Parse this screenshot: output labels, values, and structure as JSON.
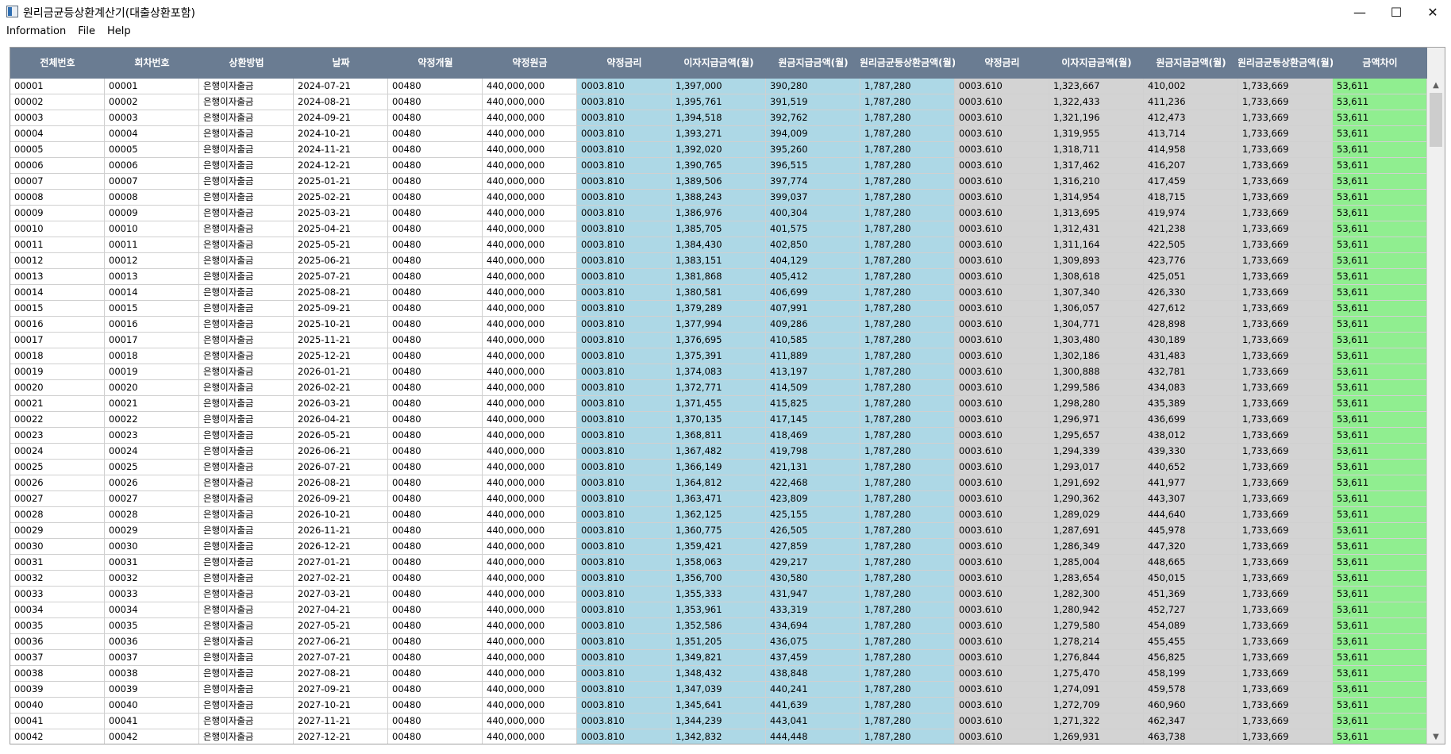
{
  "window": {
    "title": "원리금균등상환계산기(대출상환포함)",
    "controls": {
      "minimize": "—",
      "maximize": "☐",
      "close": "✕"
    }
  },
  "menu": [
    "Information",
    "File",
    "Help"
  ],
  "columns": [
    "전체번호",
    "회차번호",
    "상환방법",
    "날짜",
    "약정개월",
    "약정원금",
    "약정금리",
    "이자지급금액(월)",
    "원금지급금액(월)",
    "원리금균등상환금액(월)",
    "약정금리",
    "이자지급금액(월)",
    "원금지급금액(월)",
    "원리금균등상환금액(월)",
    "금액차이"
  ],
  "column_colors": {
    "blue": "#add8e6",
    "gray": "#d3d3d3",
    "green": "#90ee90",
    "header": "#6a7c92"
  },
  "constants": {
    "method": "은행이자출금",
    "months": "00480",
    "principal": "440,000,000",
    "rate1": "0003.810",
    "total1": "1,787,280",
    "rate2": "0003.610",
    "total2": "1,733,669",
    "diff": "53,611"
  },
  "rows": [
    {
      "no": "00001",
      "round": "00001",
      "date": "2024-07-21",
      "int1": "1,397,000",
      "prin1": "390,280",
      "int2": "1,323,667",
      "prin2": "410,002"
    },
    {
      "no": "00002",
      "round": "00002",
      "date": "2024-08-21",
      "int1": "1,395,761",
      "prin1": "391,519",
      "int2": "1,322,433",
      "prin2": "411,236"
    },
    {
      "no": "00003",
      "round": "00003",
      "date": "2024-09-21",
      "int1": "1,394,518",
      "prin1": "392,762",
      "int2": "1,321,196",
      "prin2": "412,473"
    },
    {
      "no": "00004",
      "round": "00004",
      "date": "2024-10-21",
      "int1": "1,393,271",
      "prin1": "394,009",
      "int2": "1,319,955",
      "prin2": "413,714"
    },
    {
      "no": "00005",
      "round": "00005",
      "date": "2024-11-21",
      "int1": "1,392,020",
      "prin1": "395,260",
      "int2": "1,318,711",
      "prin2": "414,958"
    },
    {
      "no": "00006",
      "round": "00006",
      "date": "2024-12-21",
      "int1": "1,390,765",
      "prin1": "396,515",
      "int2": "1,317,462",
      "prin2": "416,207"
    },
    {
      "no": "00007",
      "round": "00007",
      "date": "2025-01-21",
      "int1": "1,389,506",
      "prin1": "397,774",
      "int2": "1,316,210",
      "prin2": "417,459"
    },
    {
      "no": "00008",
      "round": "00008",
      "date": "2025-02-21",
      "int1": "1,388,243",
      "prin1": "399,037",
      "int2": "1,314,954",
      "prin2": "418,715"
    },
    {
      "no": "00009",
      "round": "00009",
      "date": "2025-03-21",
      "int1": "1,386,976",
      "prin1": "400,304",
      "int2": "1,313,695",
      "prin2": "419,974"
    },
    {
      "no": "00010",
      "round": "00010",
      "date": "2025-04-21",
      "int1": "1,385,705",
      "prin1": "401,575",
      "int2": "1,312,431",
      "prin2": "421,238"
    },
    {
      "no": "00011",
      "round": "00011",
      "date": "2025-05-21",
      "int1": "1,384,430",
      "prin1": "402,850",
      "int2": "1,311,164",
      "prin2": "422,505"
    },
    {
      "no": "00012",
      "round": "00012",
      "date": "2025-06-21",
      "int1": "1,383,151",
      "prin1": "404,129",
      "int2": "1,309,893",
      "prin2": "423,776"
    },
    {
      "no": "00013",
      "round": "00013",
      "date": "2025-07-21",
      "int1": "1,381,868",
      "prin1": "405,412",
      "int2": "1,308,618",
      "prin2": "425,051"
    },
    {
      "no": "00014",
      "round": "00014",
      "date": "2025-08-21",
      "int1": "1,380,581",
      "prin1": "406,699",
      "int2": "1,307,340",
      "prin2": "426,330"
    },
    {
      "no": "00015",
      "round": "00015",
      "date": "2025-09-21",
      "int1": "1,379,289",
      "prin1": "407,991",
      "int2": "1,306,057",
      "prin2": "427,612"
    },
    {
      "no": "00016",
      "round": "00016",
      "date": "2025-10-21",
      "int1": "1,377,994",
      "prin1": "409,286",
      "int2": "1,304,771",
      "prin2": "428,898"
    },
    {
      "no": "00017",
      "round": "00017",
      "date": "2025-11-21",
      "int1": "1,376,695",
      "prin1": "410,585",
      "int2": "1,303,480",
      "prin2": "430,189"
    },
    {
      "no": "00018",
      "round": "00018",
      "date": "2025-12-21",
      "int1": "1,375,391",
      "prin1": "411,889",
      "int2": "1,302,186",
      "prin2": "431,483"
    },
    {
      "no": "00019",
      "round": "00019",
      "date": "2026-01-21",
      "int1": "1,374,083",
      "prin1": "413,197",
      "int2": "1,300,888",
      "prin2": "432,781"
    },
    {
      "no": "00020",
      "round": "00020",
      "date": "2026-02-21",
      "int1": "1,372,771",
      "prin1": "414,509",
      "int2": "1,299,586",
      "prin2": "434,083"
    },
    {
      "no": "00021",
      "round": "00021",
      "date": "2026-03-21",
      "int1": "1,371,455",
      "prin1": "415,825",
      "int2": "1,298,280",
      "prin2": "435,389"
    },
    {
      "no": "00022",
      "round": "00022",
      "date": "2026-04-21",
      "int1": "1,370,135",
      "prin1": "417,145",
      "int2": "1,296,971",
      "prin2": "436,699"
    },
    {
      "no": "00023",
      "round": "00023",
      "date": "2026-05-21",
      "int1": "1,368,811",
      "prin1": "418,469",
      "int2": "1,295,657",
      "prin2": "438,012"
    },
    {
      "no": "00024",
      "round": "00024",
      "date": "2026-06-21",
      "int1": "1,367,482",
      "prin1": "419,798",
      "int2": "1,294,339",
      "prin2": "439,330"
    },
    {
      "no": "00025",
      "round": "00025",
      "date": "2026-07-21",
      "int1": "1,366,149",
      "prin1": "421,131",
      "int2": "1,293,017",
      "prin2": "440,652"
    },
    {
      "no": "00026",
      "round": "00026",
      "date": "2026-08-21",
      "int1": "1,364,812",
      "prin1": "422,468",
      "int2": "1,291,692",
      "prin2": "441,977"
    },
    {
      "no": "00027",
      "round": "00027",
      "date": "2026-09-21",
      "int1": "1,363,471",
      "prin1": "423,809",
      "int2": "1,290,362",
      "prin2": "443,307"
    },
    {
      "no": "00028",
      "round": "00028",
      "date": "2026-10-21",
      "int1": "1,362,125",
      "prin1": "425,155",
      "int2": "1,289,029",
      "prin2": "444,640"
    },
    {
      "no": "00029",
      "round": "00029",
      "date": "2026-11-21",
      "int1": "1,360,775",
      "prin1": "426,505",
      "int2": "1,287,691",
      "prin2": "445,978"
    },
    {
      "no": "00030",
      "round": "00030",
      "date": "2026-12-21",
      "int1": "1,359,421",
      "prin1": "427,859",
      "int2": "1,286,349",
      "prin2": "447,320"
    },
    {
      "no": "00031",
      "round": "00031",
      "date": "2027-01-21",
      "int1": "1,358,063",
      "prin1": "429,217",
      "int2": "1,285,004",
      "prin2": "448,665"
    },
    {
      "no": "00032",
      "round": "00032",
      "date": "2027-02-21",
      "int1": "1,356,700",
      "prin1": "430,580",
      "int2": "1,283,654",
      "prin2": "450,015"
    },
    {
      "no": "00033",
      "round": "00033",
      "date": "2027-03-21",
      "int1": "1,355,333",
      "prin1": "431,947",
      "int2": "1,282,300",
      "prin2": "451,369"
    },
    {
      "no": "00034",
      "round": "00034",
      "date": "2027-04-21",
      "int1": "1,353,961",
      "prin1": "433,319",
      "int2": "1,280,942",
      "prin2": "452,727"
    },
    {
      "no": "00035",
      "round": "00035",
      "date": "2027-05-21",
      "int1": "1,352,586",
      "prin1": "434,694",
      "int2": "1,279,580",
      "prin2": "454,089"
    },
    {
      "no": "00036",
      "round": "00036",
      "date": "2027-06-21",
      "int1": "1,351,205",
      "prin1": "436,075",
      "int2": "1,278,214",
      "prin2": "455,455"
    },
    {
      "no": "00037",
      "round": "00037",
      "date": "2027-07-21",
      "int1": "1,349,821",
      "prin1": "437,459",
      "int2": "1,276,844",
      "prin2": "456,825"
    },
    {
      "no": "00038",
      "round": "00038",
      "date": "2027-08-21",
      "int1": "1,348,432",
      "prin1": "438,848",
      "int2": "1,275,470",
      "prin2": "458,199"
    },
    {
      "no": "00039",
      "round": "00039",
      "date": "2027-09-21",
      "int1": "1,347,039",
      "prin1": "440,241",
      "int2": "1,274,091",
      "prin2": "459,578"
    },
    {
      "no": "00040",
      "round": "00040",
      "date": "2027-10-21",
      "int1": "1,345,641",
      "prin1": "441,639",
      "int2": "1,272,709",
      "prin2": "460,960"
    },
    {
      "no": "00041",
      "round": "00041",
      "date": "2027-11-21",
      "int1": "1,344,239",
      "prin1": "443,041",
      "int2": "1,271,322",
      "prin2": "462,347"
    },
    {
      "no": "00042",
      "round": "00042",
      "date": "2027-12-21",
      "int1": "1,342,832",
      "prin1": "444,448",
      "int2": "1,269,931",
      "prin2": "463,738"
    }
  ]
}
